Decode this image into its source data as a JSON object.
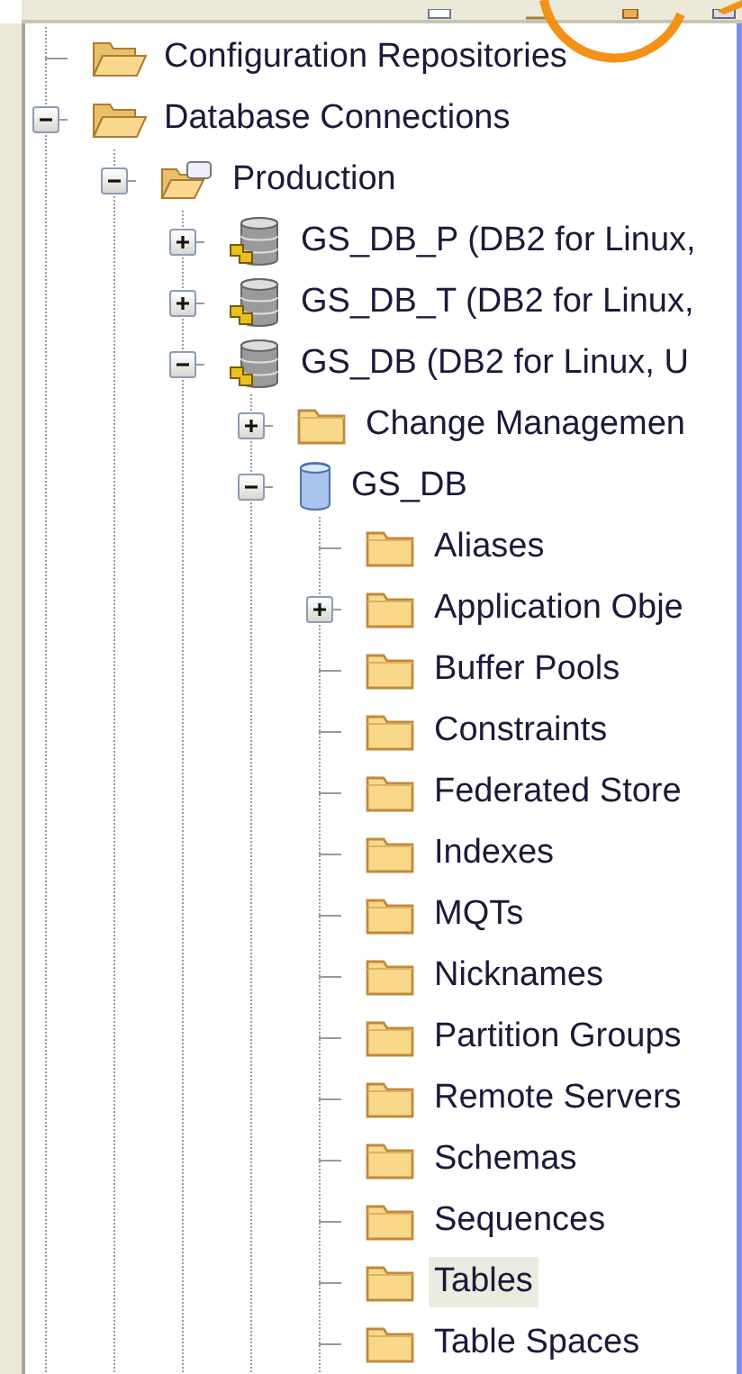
{
  "tree": [
    {
      "label": "Configuration Repositories",
      "kind": "folder-open",
      "selected": false
    },
    {
      "label": "Database Connections",
      "kind": "folder-open",
      "selected": false,
      "expanded": true,
      "children": [
        {
          "label": "Production",
          "kind": "connection-folder",
          "selected": false,
          "expanded": true,
          "children": [
            {
              "label": "GS_DB_P (DB2 for Linux,",
              "kind": "database-server",
              "selected": false,
              "expanded": false
            },
            {
              "label": "GS_DB_T (DB2 for Linux,",
              "kind": "database-server",
              "selected": false,
              "expanded": false
            },
            {
              "label": "GS_DB (DB2 for Linux, U",
              "kind": "database-server",
              "selected": false,
              "expanded": true,
              "children": [
                {
                  "label": "Change Managemen",
                  "kind": "folder",
                  "selected": false,
                  "expanded": false
                },
                {
                  "label": "GS_DB",
                  "kind": "database",
                  "selected": false,
                  "expanded": true,
                  "children": [
                    {
                      "label": "Aliases",
                      "kind": "folder",
                      "selected": false
                    },
                    {
                      "label": "Application Obje",
                      "kind": "folder",
                      "selected": false,
                      "expanded": false
                    },
                    {
                      "label": "Buffer Pools",
                      "kind": "folder",
                      "selected": false
                    },
                    {
                      "label": "Constraints",
                      "kind": "folder",
                      "selected": false
                    },
                    {
                      "label": "Federated Store",
                      "kind": "folder",
                      "selected": false
                    },
                    {
                      "label": "Indexes",
                      "kind": "folder",
                      "selected": false
                    },
                    {
                      "label": "MQTs",
                      "kind": "folder",
                      "selected": false
                    },
                    {
                      "label": "Nicknames",
                      "kind": "folder",
                      "selected": false
                    },
                    {
                      "label": "Partition Groups",
                      "kind": "folder",
                      "selected": false
                    },
                    {
                      "label": "Remote Servers",
                      "kind": "folder",
                      "selected": false
                    },
                    {
                      "label": "Schemas",
                      "kind": "folder",
                      "selected": false
                    },
                    {
                      "label": "Sequences",
                      "kind": "folder",
                      "selected": false
                    },
                    {
                      "label": "Tables",
                      "kind": "folder",
                      "selected": true
                    },
                    {
                      "label": "Table Spaces",
                      "kind": "folder",
                      "selected": false
                    }
                  ]
                }
              ]
            }
          ]
        }
      ]
    }
  ]
}
